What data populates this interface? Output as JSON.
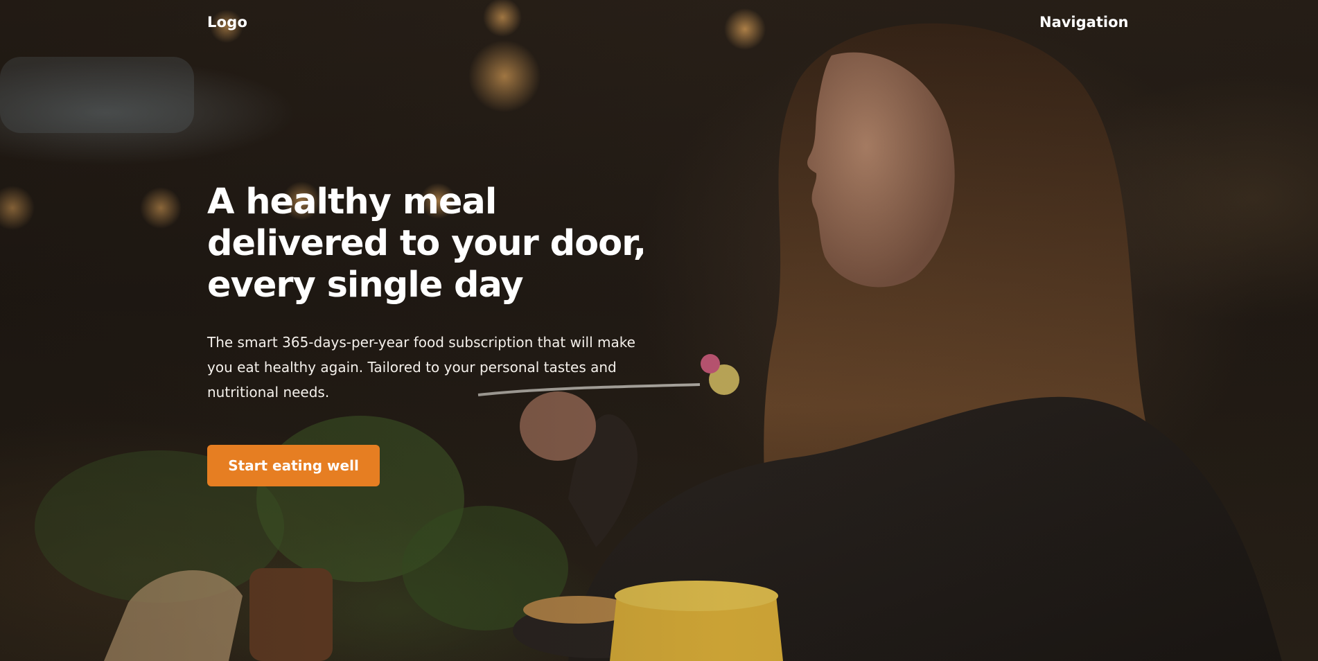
{
  "header": {
    "logo": "Logo",
    "nav_label": "Navigation"
  },
  "hero": {
    "headline": "A healthy meal delivered to your door, every single day",
    "subheading": "The smart 365-days-per-year food subscription that will make you eat healthy again. Tailored to your personal tastes and nutritional needs.",
    "cta_label": "Start eating well"
  },
  "colors": {
    "accent": "#e67e22",
    "text": "#ffffff",
    "background_overlay": "#221b15"
  },
  "background_image": "woman-eating-salad-in-cafe-photo"
}
